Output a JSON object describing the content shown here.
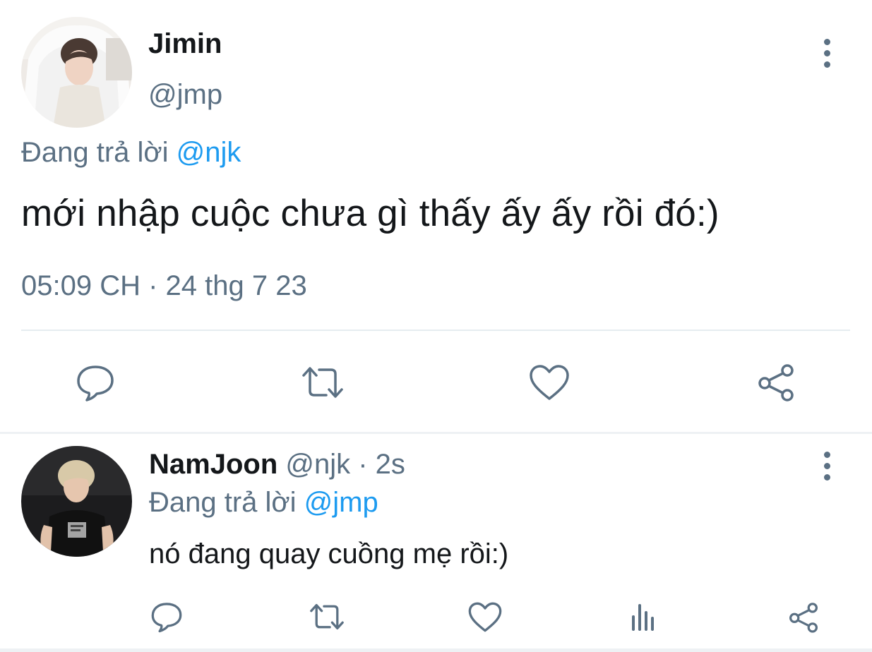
{
  "main_tweet": {
    "author_name": "Jimin",
    "author_handle": "@jmp",
    "replying_prefix": "Đang trả lời ",
    "replying_to": "@njk",
    "text": "mới nhập cuộc chưa gì thấy ấy ấy rồi đó:)",
    "timestamp": "05:09 CH",
    "separator": " · ",
    "date": "24 thg 7 23",
    "actions": [
      "reply-icon",
      "retweet-icon",
      "like-icon",
      "share-icon"
    ]
  },
  "reply_tweet": {
    "author_name": "NamJoon",
    "author_handle": "@njk",
    "time_separator": " · ",
    "time_ago": "2s",
    "replying_prefix": "Đang trả lời ",
    "replying_to": "@jmp",
    "text": "nó đang quay cuồng mẹ rồi:)",
    "actions": [
      "reply-icon",
      "retweet-icon",
      "like-icon",
      "analytics-icon",
      "share-icon"
    ]
  },
  "colors": {
    "text_primary": "#14171a",
    "text_secondary": "#5b7083",
    "link": "#1d9bf0",
    "divider": "#e6ecf0"
  }
}
